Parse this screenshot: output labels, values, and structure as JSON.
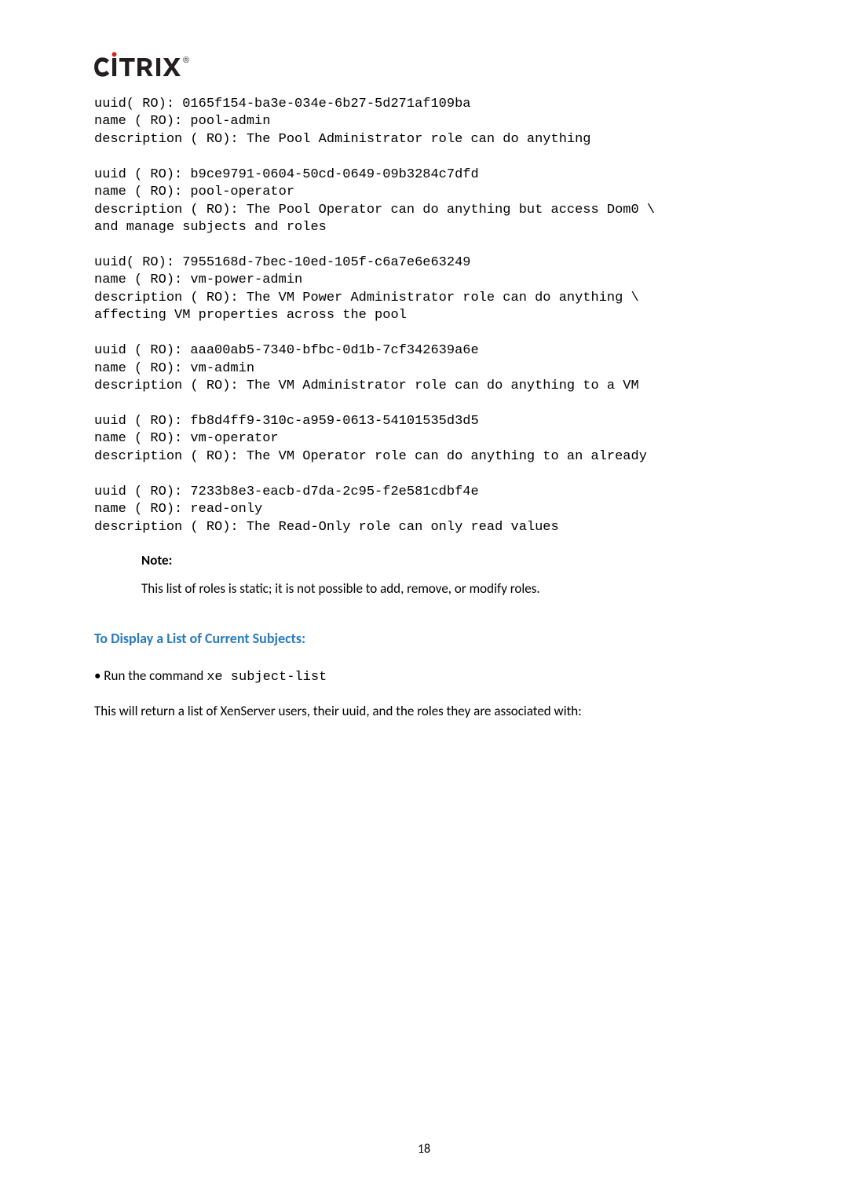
{
  "logo": {
    "text": "CİTRIX",
    "dot_color": "#d9261c",
    "letter_color": "#231f20"
  },
  "code": "uuid( RO): 0165f154-ba3e-034e-6b27-5d271af109ba\nname ( RO): pool-admin\ndescription ( RO): The Pool Administrator role can do anything\n\nuuid ( RO): b9ce9791-0604-50cd-0649-09b3284c7dfd\nname ( RO): pool-operator\ndescription ( RO): The Pool Operator can do anything but access Dom0 \\\nand manage subjects and roles\n\nuuid( RO): 7955168d-7bec-10ed-105f-c6a7e6e63249\nname ( RO): vm-power-admin\ndescription ( RO): The VM Power Administrator role can do anything \\\naffecting VM properties across the pool\n\nuuid ( RO): aaa00ab5-7340-bfbc-0d1b-7cf342639a6e\nname ( RO): vm-admin\ndescription ( RO): The VM Administrator role can do anything to a VM\n\nuuid ( RO): fb8d4ff9-310c-a959-0613-54101535d3d5\nname ( RO): vm-operator\ndescription ( RO): The VM Operator role can do anything to an already\n\nuuid ( RO): 7233b8e3-eacb-d7da-2c95-f2e581cdbf4e\nname ( RO): read-only\ndescription ( RO): The Read-Only role can only read values",
  "note": {
    "label": "Note:",
    "text": "This list of roles is static; it is not possible to add, remove, or modify roles."
  },
  "heading": "To Display a List of Current Subjects:",
  "bullet": {
    "prefix": "• Run the command ",
    "code": "xe subject-list"
  },
  "body": "This will return a list of XenServer users, their uuid, and the roles they are associated with:",
  "page_number": "18"
}
